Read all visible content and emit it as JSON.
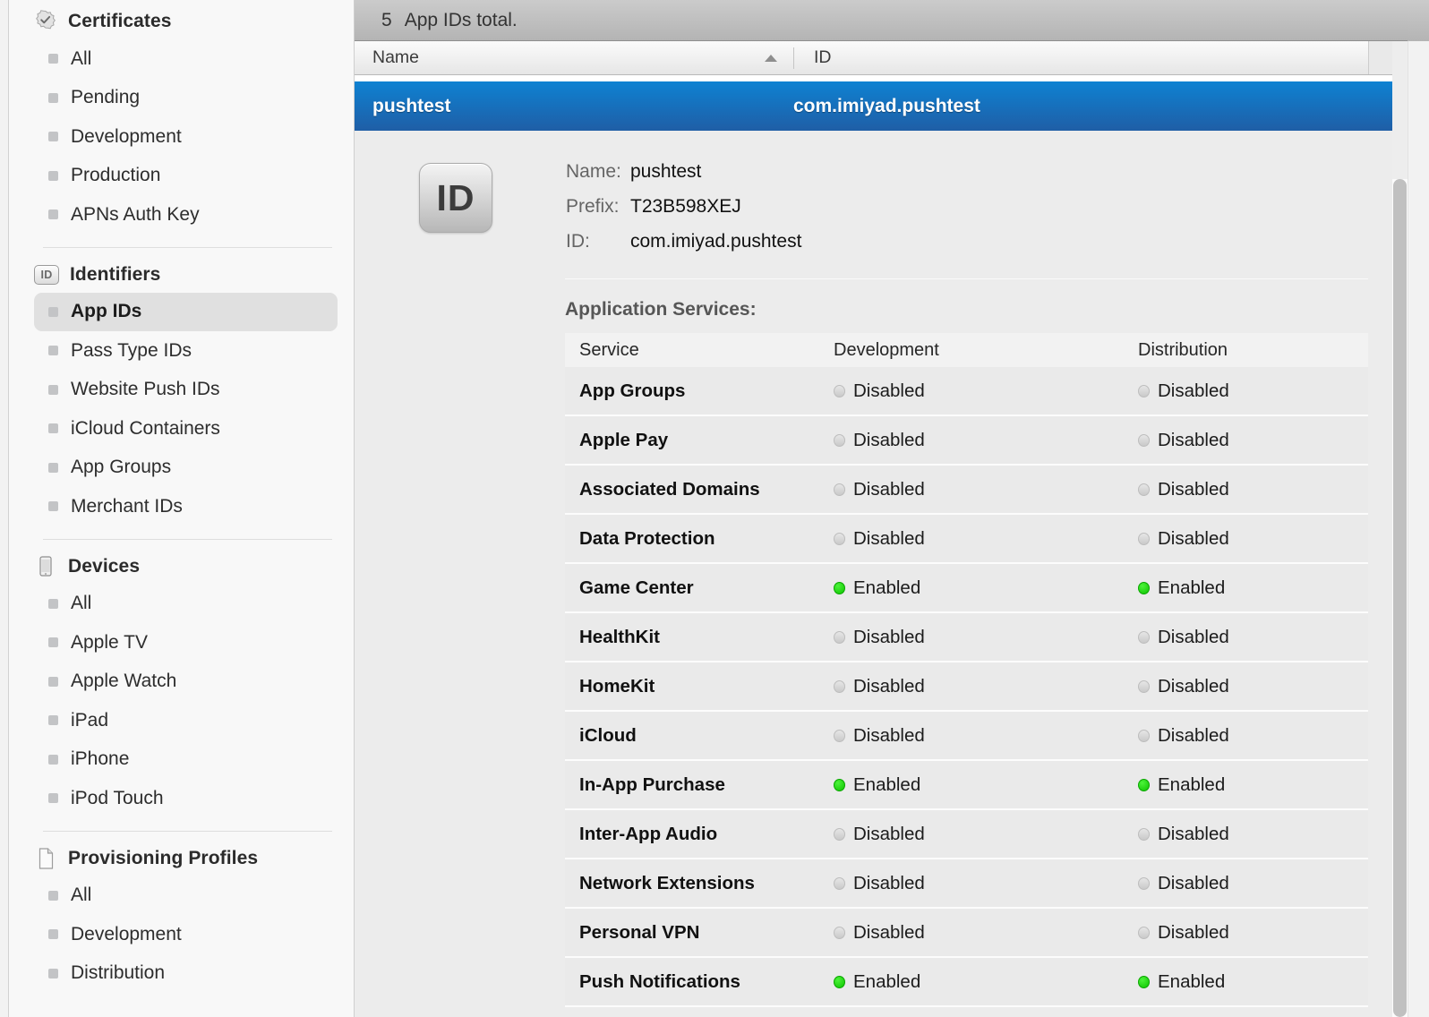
{
  "sidebar": {
    "sections": [
      {
        "title": "Certificates",
        "icon": "certificate-seal-icon",
        "items": [
          {
            "label": "All",
            "selected": false
          },
          {
            "label": "Pending",
            "selected": false
          },
          {
            "label": "Development",
            "selected": false
          },
          {
            "label": "Production",
            "selected": false
          },
          {
            "label": "APNs Auth Key",
            "selected": false
          }
        ]
      },
      {
        "title": "Identifiers",
        "icon": "id-badge-icon",
        "items": [
          {
            "label": "App IDs",
            "selected": true
          },
          {
            "label": "Pass Type IDs",
            "selected": false
          },
          {
            "label": "Website Push IDs",
            "selected": false
          },
          {
            "label": "iCloud Containers",
            "selected": false
          },
          {
            "label": "App Groups",
            "selected": false
          },
          {
            "label": "Merchant IDs",
            "selected": false
          }
        ]
      },
      {
        "title": "Devices",
        "icon": "device-phone-icon",
        "items": [
          {
            "label": "All",
            "selected": false
          },
          {
            "label": "Apple TV",
            "selected": false
          },
          {
            "label": "Apple Watch",
            "selected": false
          },
          {
            "label": "iPad",
            "selected": false
          },
          {
            "label": "iPhone",
            "selected": false
          },
          {
            "label": "iPod Touch",
            "selected": false
          }
        ]
      },
      {
        "title": "Provisioning Profiles",
        "icon": "document-page-icon",
        "items": [
          {
            "label": "All",
            "selected": false
          },
          {
            "label": "Development",
            "selected": false
          },
          {
            "label": "Distribution",
            "selected": false
          }
        ]
      }
    ]
  },
  "toolbar": {
    "count": "5",
    "text": "App IDs total."
  },
  "list": {
    "columns": {
      "name": "Name",
      "id": "ID"
    },
    "sort_indicator": "ascending-sort-arrow-icon",
    "selected_row": {
      "name": "pushtest",
      "id": "com.imiyad.pushtest"
    }
  },
  "detail": {
    "badge_text": "ID",
    "fields": [
      {
        "label": "Name:",
        "value": "pushtest"
      },
      {
        "label": "Prefix:",
        "value": "T23B598XEJ"
      },
      {
        "label": "ID:",
        "value": "com.imiyad.pushtest"
      }
    ],
    "section_title": "Application Services:",
    "services_header": {
      "service": "Service",
      "development": "Development",
      "distribution": "Distribution"
    },
    "services": [
      {
        "name": "App Groups",
        "development": "Disabled",
        "distribution": "Disabled",
        "dev_on": false,
        "dist_on": false
      },
      {
        "name": "Apple Pay",
        "development": "Disabled",
        "distribution": "Disabled",
        "dev_on": false,
        "dist_on": false
      },
      {
        "name": "Associated Domains",
        "development": "Disabled",
        "distribution": "Disabled",
        "dev_on": false,
        "dist_on": false
      },
      {
        "name": "Data Protection",
        "development": "Disabled",
        "distribution": "Disabled",
        "dev_on": false,
        "dist_on": false
      },
      {
        "name": "Game Center",
        "development": "Enabled",
        "distribution": "Enabled",
        "dev_on": true,
        "dist_on": true
      },
      {
        "name": "HealthKit",
        "development": "Disabled",
        "distribution": "Disabled",
        "dev_on": false,
        "dist_on": false
      },
      {
        "name": "HomeKit",
        "development": "Disabled",
        "distribution": "Disabled",
        "dev_on": false,
        "dist_on": false
      },
      {
        "name": "iCloud",
        "development": "Disabled",
        "distribution": "Disabled",
        "dev_on": false,
        "dist_on": false
      },
      {
        "name": "In-App Purchase",
        "development": "Enabled",
        "distribution": "Enabled",
        "dev_on": true,
        "dist_on": true
      },
      {
        "name": "Inter-App Audio",
        "development": "Disabled",
        "distribution": "Disabled",
        "dev_on": false,
        "dist_on": false
      },
      {
        "name": "Network Extensions",
        "development": "Disabled",
        "distribution": "Disabled",
        "dev_on": false,
        "dist_on": false
      },
      {
        "name": "Personal VPN",
        "development": "Disabled",
        "distribution": "Disabled",
        "dev_on": false,
        "dist_on": false
      },
      {
        "name": "Push Notifications",
        "development": "Enabled",
        "distribution": "Enabled",
        "dev_on": true,
        "dist_on": true
      }
    ]
  },
  "colors": {
    "selection_blue_top": "#0e82d2",
    "selection_blue_bottom": "#1f5ea6",
    "enabled_green": "#0ec400",
    "disabled_gray": "#c9c9c9"
  }
}
